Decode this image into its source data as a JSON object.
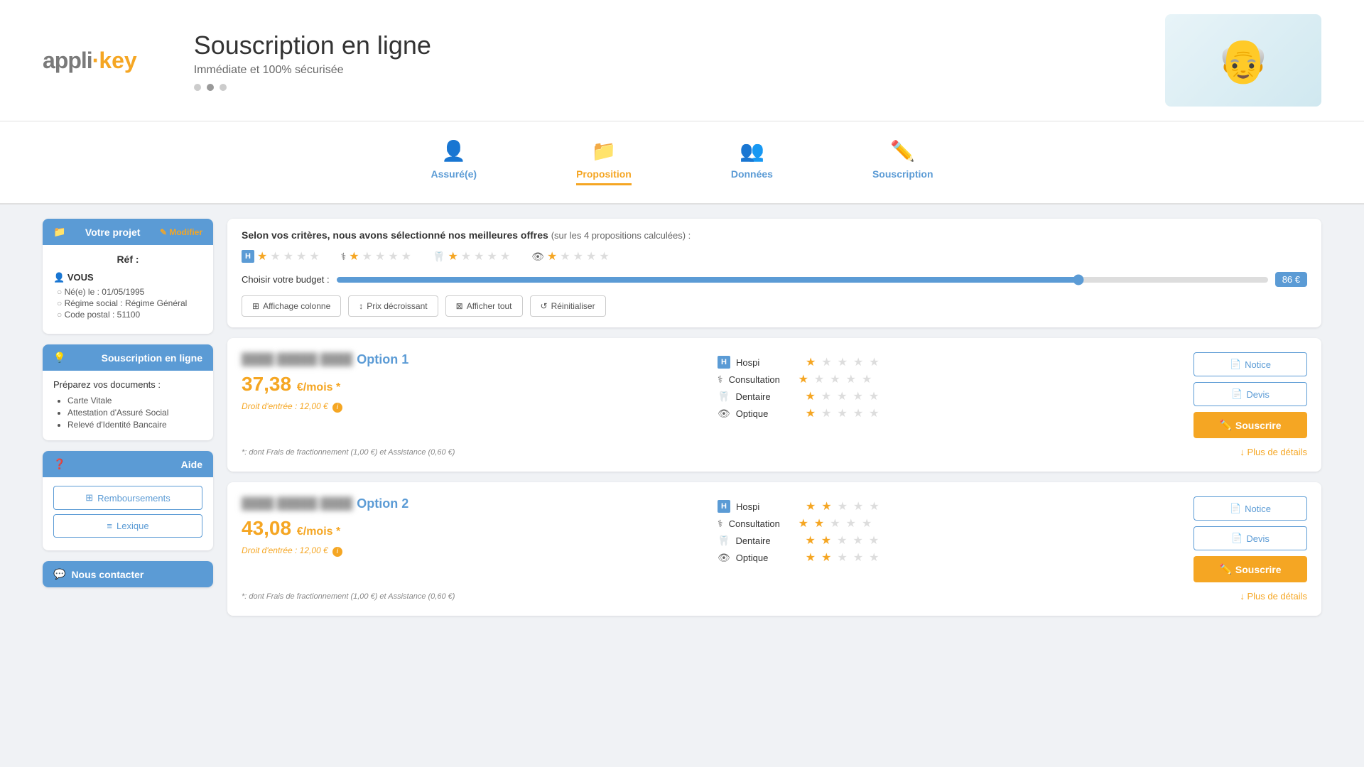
{
  "header": {
    "logo_appli": "appli·",
    "logo_key": "key",
    "title": "Souscription en ligne",
    "subtitle": "Immédiate et 100% sécurisée",
    "dots": [
      false,
      true,
      false
    ]
  },
  "steps": [
    {
      "id": "assure",
      "label": "Assuré(e)",
      "icon": "👤",
      "active": false
    },
    {
      "id": "proposition",
      "label": "Proposition",
      "icon": "📁",
      "active": true
    },
    {
      "id": "donnees",
      "label": "Données",
      "icon": "👥",
      "active": false
    },
    {
      "id": "souscription",
      "label": "Souscription",
      "icon": "✏️",
      "active": false
    }
  ],
  "sidebar": {
    "project_title": "Votre projet",
    "modify_label": "✎ Modifier",
    "ref_label": "Réf :",
    "user_label": "VOUS",
    "user_details": [
      "Né(e) le : 01/05/1995",
      "Régime social : Régime Général",
      "Code postal : 51100"
    ],
    "souscription_title": "Souscription en ligne",
    "doc_intro": "Préparez vos documents :",
    "documents": [
      "Carte Vitale",
      "Attestation d'Assuré Social",
      "Relevé d'Identité Bancaire"
    ],
    "aide_title": "Aide",
    "remboursements_label": "Remboursements",
    "lexique_label": "Lexique",
    "nous_contacter_title": "Nous contacter"
  },
  "filter": {
    "title": "Selon vos critères, nous avons sélectionné nos meilleures offres",
    "subtitle": "(sur les 4 propositions calculées) :",
    "budget_label": "Choisir votre budget :",
    "budget_value": "86 €",
    "star_groups": [
      {
        "icon": "H",
        "stars": [
          true,
          false,
          false,
          false,
          false
        ]
      },
      {
        "icon": "⚕",
        "stars": [
          true,
          false,
          false,
          false,
          false
        ]
      },
      {
        "icon": "🦷",
        "stars": [
          true,
          false,
          false,
          false,
          false
        ]
      },
      {
        "icon": "👁",
        "stars": [
          true,
          false,
          false,
          false,
          false
        ]
      }
    ],
    "buttons": [
      {
        "icon": "⊞",
        "label": "Affichage colonne"
      },
      {
        "icon": "↕",
        "label": "Prix décroissant"
      },
      {
        "icon": "⊠",
        "label": "Afficher tout"
      },
      {
        "icon": "↺",
        "label": "Réinitialiser"
      }
    ]
  },
  "offers": [
    {
      "id": "offer1",
      "name_blurred": "████ █████ ████",
      "option": "Option 1",
      "price": "37,38",
      "price_unit": "€/mois *",
      "droit_entree": "Droit d'entrée : 12,00 €",
      "ratings": [
        {
          "icon": "H",
          "label": "Hospi",
          "stars": [
            true,
            false,
            false,
            false,
            false
          ]
        },
        {
          "icon": "⚕",
          "label": "Consultation",
          "stars": [
            true,
            false,
            false,
            false,
            false
          ]
        },
        {
          "icon": "🦷",
          "label": "Dentaire",
          "stars": [
            true,
            false,
            false,
            false,
            false
          ]
        },
        {
          "icon": "👁",
          "label": "Optique",
          "stars": [
            true,
            false,
            false,
            false,
            false
          ]
        }
      ],
      "note": "*: dont Frais de fractionnement (1,00 €) et Assistance (0,60 €)",
      "notice_label": "Notice",
      "devis_label": "Devis",
      "souscrire_label": "Souscrire",
      "plus_details": "↓ Plus de détails"
    },
    {
      "id": "offer2",
      "name_blurred": "████ █████ ████",
      "option": "Option 2",
      "price": "43,08",
      "price_unit": "€/mois *",
      "droit_entree": "Droit d'entrée : 12,00 €",
      "ratings": [
        {
          "icon": "H",
          "label": "Hospi",
          "stars": [
            true,
            true,
            false,
            false,
            false
          ]
        },
        {
          "icon": "⚕",
          "label": "Consultation",
          "stars": [
            true,
            true,
            false,
            false,
            false
          ]
        },
        {
          "icon": "🦷",
          "label": "Dentaire",
          "stars": [
            true,
            true,
            false,
            false,
            false
          ]
        },
        {
          "icon": "👁",
          "label": "Optique",
          "stars": [
            true,
            true,
            false,
            false,
            false
          ]
        }
      ],
      "note": "*: dont Frais de fractionnement (1,00 €) et Assistance (0,60 €)",
      "notice_label": "Notice",
      "devis_label": "Devis",
      "souscrire_label": "Souscrire",
      "plus_details": "↓ Plus de détails"
    }
  ]
}
